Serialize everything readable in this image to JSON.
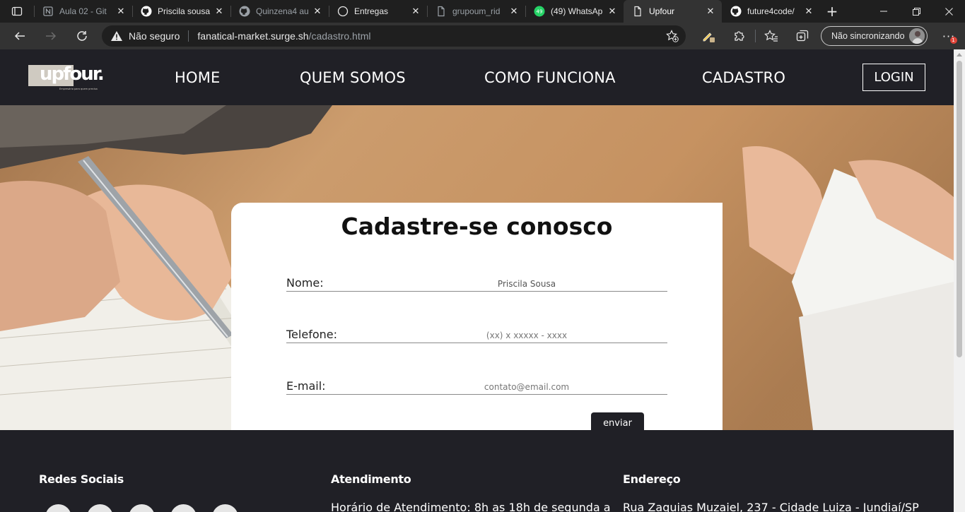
{
  "browser": {
    "tabs": [
      {
        "title": "Aula 02 - Git",
        "icon": "notion-icon"
      },
      {
        "title": "Priscila sousa",
        "icon": "github-icon"
      },
      {
        "title": "Quinzena4 au",
        "icon": "github-icon"
      },
      {
        "title": "Entregas",
        "icon": "circle-icon"
      },
      {
        "title": "grupoum_rid",
        "icon": "document-icon"
      },
      {
        "title": "(49) WhatsAp",
        "icon": "whatsapp-icon",
        "badge": "49"
      },
      {
        "title": "Upfour",
        "icon": "document-icon",
        "active": true
      },
      {
        "title": "future4code/",
        "icon": "github-icon"
      }
    ],
    "security_label": "Não seguro",
    "url_host": "fanatical-market.surge.sh",
    "url_path": "/cadastro.html",
    "sync_label": "Não sincronizando",
    "notification_badge": "1",
    "accent_color": "#e0453a"
  },
  "site": {
    "logo_text": "upfour.",
    "logo_tagline": "Empresário para quem precisa",
    "nav": [
      {
        "label": "HOME"
      },
      {
        "label": "QUEM SOMOS"
      },
      {
        "label": "COMO FUNCIONA"
      },
      {
        "label": "CADASTRO"
      }
    ],
    "login_label": "LOGIN",
    "form": {
      "title": "Cadastre-se conosco",
      "fields": [
        {
          "label": "Nome:",
          "value": "Priscila Sousa",
          "placeholder": ""
        },
        {
          "label": "Telefone:",
          "value": "",
          "placeholder": "(xx) x xxxxx - xxxx"
        },
        {
          "label": "E-mail:",
          "value": "",
          "placeholder": "contato@email.com"
        }
      ],
      "submit_label": "enviar"
    },
    "footer": {
      "social_heading": "Redes Sociais",
      "service_heading": "Atendimento",
      "service_text": "Horário de Atendimento: 8h as 18h de segunda a",
      "address_heading": "Endereço",
      "address_text": "Rua Zaquias Muzaiel, 237 - Cidade Luiza - Jundiaí/SP",
      "social_icons": [
        "instagram-icon",
        "linkedin-icon",
        "twitter-icon",
        "youtube-icon",
        "pinterest-icon"
      ]
    },
    "colors": {
      "header_bg": "#202026",
      "card_bg": "#ffffff",
      "button_bg": "#202026"
    }
  }
}
